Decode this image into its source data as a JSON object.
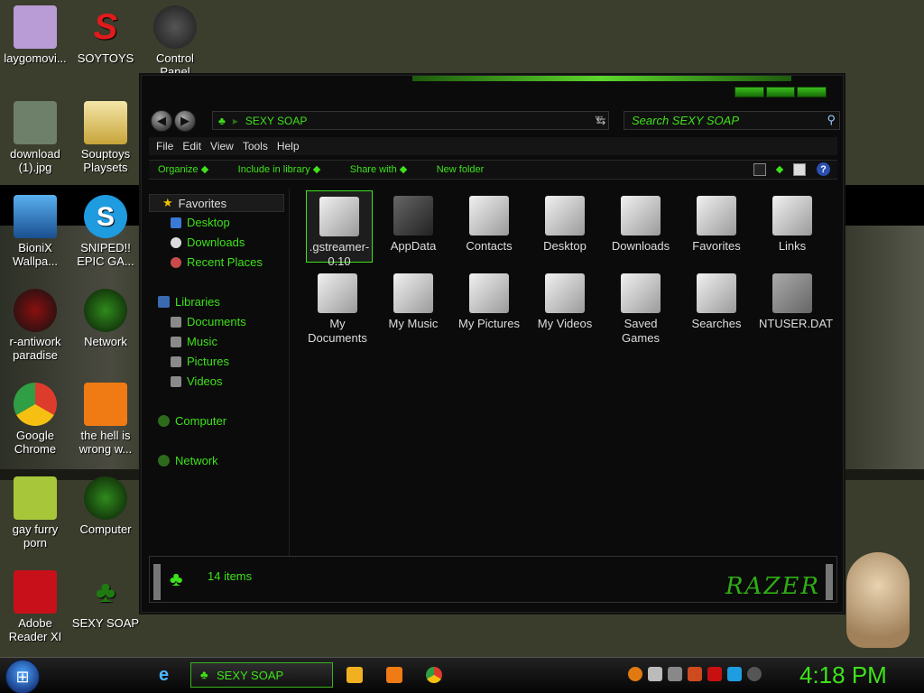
{
  "desktop_icons": [
    {
      "label": "laygomovi...",
      "color": "#b99bd6"
    },
    {
      "label": "SOYTOYS",
      "color": "#e01b1b"
    },
    {
      "label": "Control Panel",
      "color": "#4a4a4a"
    },
    {
      "label": "download (1).jpg",
      "color": "#6e7f6a"
    },
    {
      "label": "Souptoys Playsets",
      "color": "#c8a53a"
    },
    {
      "label": "BioniX Wallpa...",
      "color": "#2f6db6"
    },
    {
      "label": "SNIPED!! EPIC GA...",
      "color": "#1f9be0"
    },
    {
      "label": "r-antiwork paradise",
      "color": "#8a1010"
    },
    {
      "label": "Network",
      "color": "#1e3d12"
    },
    {
      "label": "Google Chrome",
      "color": "#dd3c2d"
    },
    {
      "label": "the hell is wrong w...",
      "color": "#f07a13"
    },
    {
      "label": "gay furry porn",
      "color": "#a8c63a"
    },
    {
      "label": "Computer",
      "color": "#1e3d12"
    },
    {
      "label": "Adobe Reader XI",
      "color": "#c8101a"
    },
    {
      "label": "SEXY SOAP",
      "color": "#1f7a12"
    }
  ],
  "window": {
    "address": "SEXY SOAP",
    "search_placeholder": "Search SEXY SOAP",
    "menu": [
      "File",
      "Edit",
      "View",
      "Tools",
      "Help"
    ],
    "commands": [
      "Organize",
      "Include in library",
      "Share with",
      "New folder"
    ],
    "help": "?",
    "nav": {
      "favorites": "Favorites",
      "fav_items": [
        "Desktop",
        "Downloads",
        "Recent Places"
      ],
      "libraries": "Libraries",
      "lib_items": [
        "Documents",
        "Music",
        "Pictures",
        "Videos"
      ],
      "computer": "Computer",
      "network": "Network"
    },
    "files": [
      {
        "label": ".gstreamer-0.10",
        "selected": true
      },
      {
        "label": "AppData"
      },
      {
        "label": "Contacts"
      },
      {
        "label": "Desktop"
      },
      {
        "label": "Downloads"
      },
      {
        "label": "Favorites"
      },
      {
        "label": "Links"
      },
      {
        "label": "My Documents"
      },
      {
        "label": "My Music"
      },
      {
        "label": "My Pictures"
      },
      {
        "label": "My Videos"
      },
      {
        "label": "Saved Games"
      },
      {
        "label": "Searches"
      },
      {
        "label": "NTUSER.DAT"
      }
    ],
    "status_count": "14 items",
    "brand_logo": "RAZER"
  },
  "taskbar": {
    "active_task": "SEXY SOAP",
    "clock": "4:18 PM"
  }
}
